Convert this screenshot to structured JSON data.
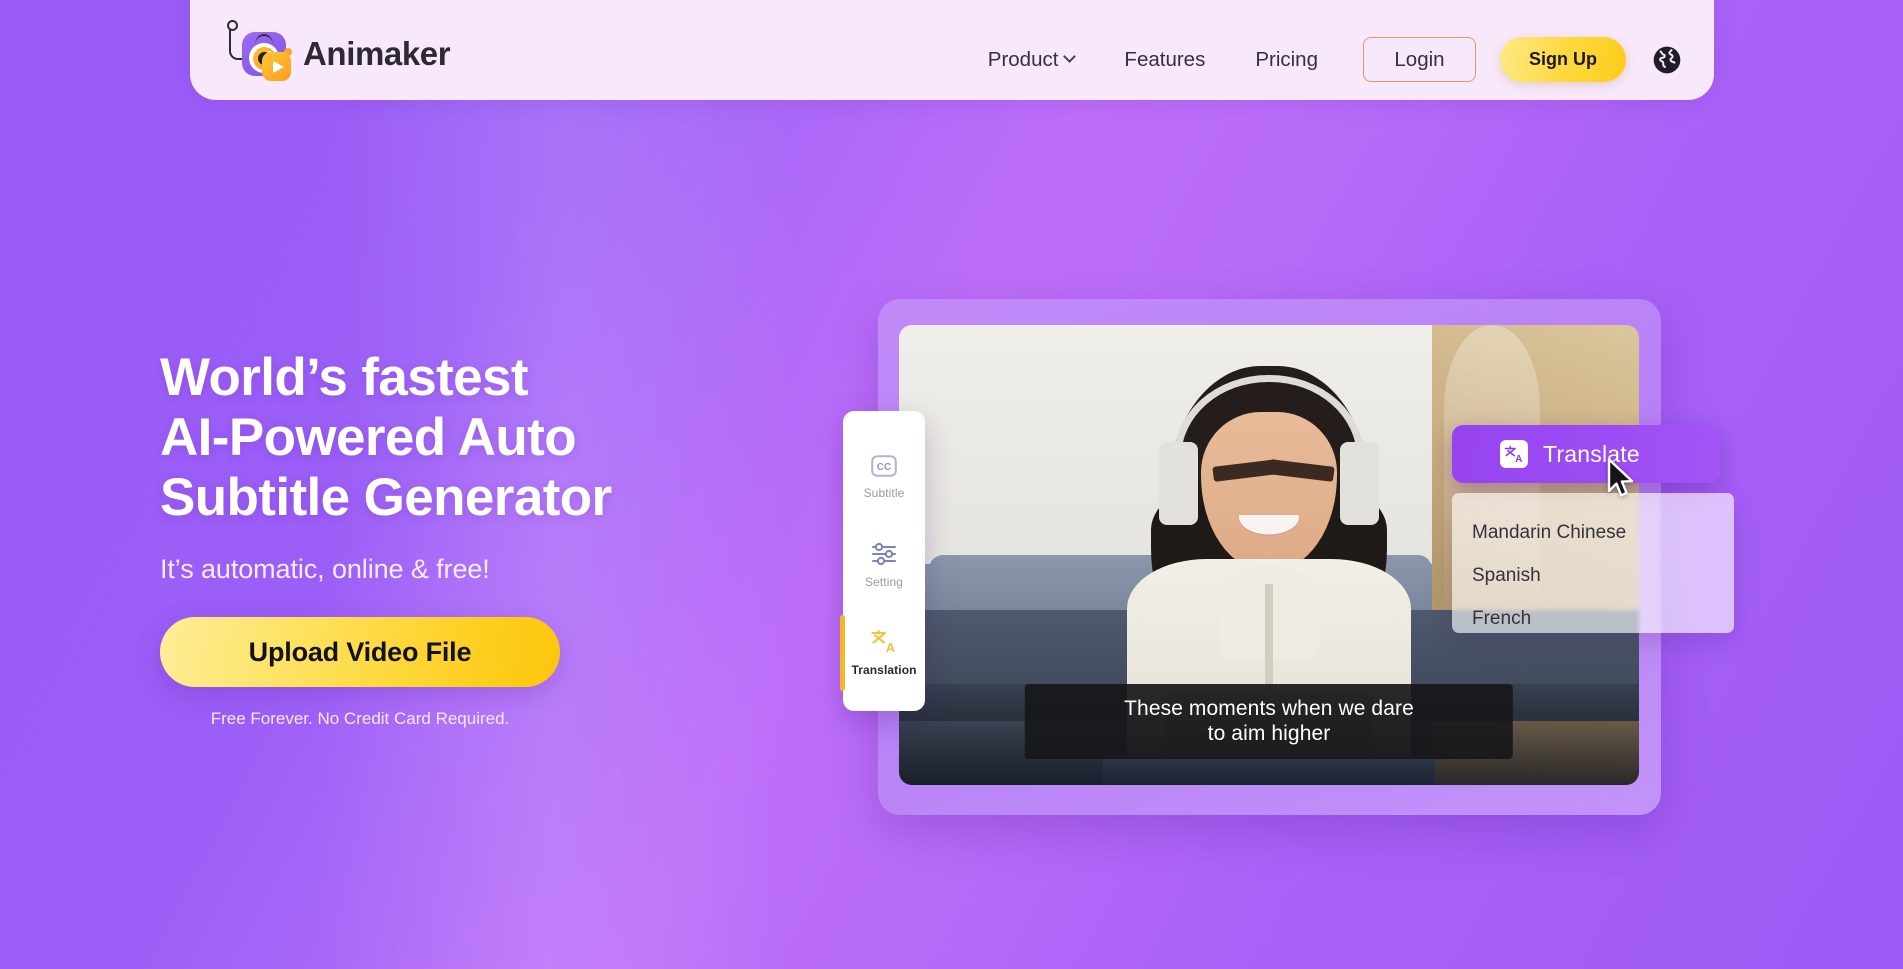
{
  "brand": {
    "name": "Animaker",
    "logo_icon": "animaker-camera-play-logo"
  },
  "nav": {
    "items": [
      {
        "label": "Product",
        "has_dropdown": true,
        "icon": "chevron-down-icon"
      },
      {
        "label": "Features",
        "has_dropdown": false
      },
      {
        "label": "Pricing",
        "has_dropdown": false
      }
    ],
    "login_label": "Login",
    "signup_label": "Sign Up",
    "language_icon": "globe-icon"
  },
  "hero": {
    "title_line1": "World’s fastest",
    "title_line2": "AI-Powered Auto",
    "title_line3": "Subtitle Generator",
    "subtitle": "It’s automatic, online & free!",
    "cta_label": "Upload Video File",
    "note": "Free Forever. No Credit Card Required."
  },
  "preview": {
    "caption_line1": "These moments when we dare",
    "caption_line2": "to aim higher",
    "tools": [
      {
        "label": "Subtitle",
        "icon": "closed-caption-icon",
        "active": false
      },
      {
        "label": "Setting",
        "icon": "sliders-icon",
        "active": false
      },
      {
        "label": "Translation",
        "icon": "translate-icon",
        "active": true
      }
    ],
    "translate_button": {
      "label": "Translate",
      "icon": "translate-icon"
    },
    "languages": [
      {
        "label": "Mandarin Chinese"
      },
      {
        "label": "Spanish"
      },
      {
        "label": "French"
      }
    ],
    "cursor_icon": "mouse-pointer-icon"
  },
  "colors": {
    "background_purple": "#9a5cf7",
    "background_purple_light": "#bd6ef9",
    "header_bg": "#f8e8fb",
    "accent_yellow": "#fdd93f",
    "cta_yellow": "#fde05c",
    "translate_purple": "#9744f0",
    "card_frame_purple": "#b781f6",
    "login_border": "#e49a5e",
    "active_tool_bar": "#f5b72a",
    "text_dark": "#2d2a35",
    "text_white": "#ffffff"
  }
}
